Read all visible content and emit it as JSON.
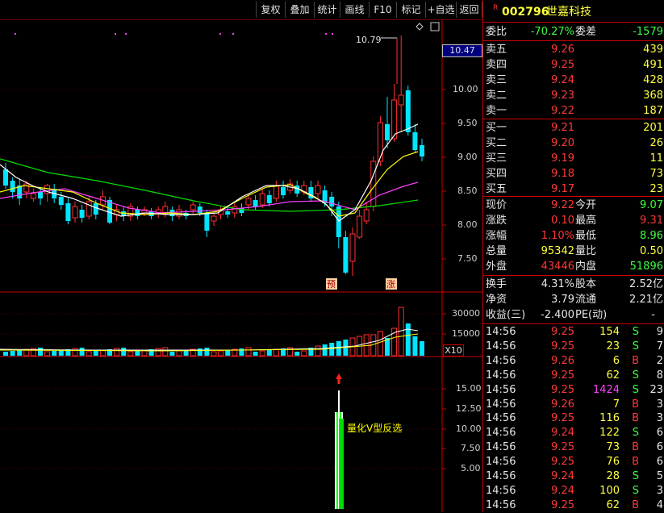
{
  "toolbar": {
    "buttons": [
      "复权",
      "叠加",
      "统计",
      "画线",
      "F10",
      "标记",
      "+自选",
      "返回"
    ]
  },
  "stock": {
    "marker": "R",
    "code": "002796",
    "name": "世嘉科技"
  },
  "price_axis": {
    "current_box": "10.47",
    "ticks": [
      "10.00",
      "9.50",
      "9.00",
      "8.50",
      "8.00",
      "7.50"
    ]
  },
  "high_annotation": "10.79",
  "signal_marks": {
    "yu": "预",
    "zhang": "涨"
  },
  "volume_axis": {
    "ticks": [
      "30000",
      "15000"
    ],
    "multiplier": "X10"
  },
  "indicator_axis": {
    "ticks": [
      "15.00",
      "12.50",
      "10.00",
      "7.50",
      "5.00"
    ],
    "label": "量化V型反选"
  },
  "colors": {
    "up": "#ff3030",
    "down": "#00e5ff",
    "ma5": "#ffffff",
    "ma10": "#ffff00",
    "ma20": "#ff40ff",
    "ma60": "#00ff00"
  },
  "order_book": {
    "wei_bi_label": "委比",
    "wei_bi": "-70.27%",
    "wei_cha_label": "委差",
    "wei_cha": "-1579",
    "asks": [
      {
        "label": "卖五",
        "price": "9.26",
        "vol": "439"
      },
      {
        "label": "卖四",
        "price": "9.25",
        "vol": "491"
      },
      {
        "label": "卖三",
        "price": "9.24",
        "vol": "428"
      },
      {
        "label": "卖二",
        "price": "9.23",
        "vol": "368"
      },
      {
        "label": "卖一",
        "price": "9.22",
        "vol": "187"
      }
    ],
    "bids": [
      {
        "label": "买一",
        "price": "9.21",
        "vol": "201"
      },
      {
        "label": "买二",
        "price": "9.20",
        "vol": "26"
      },
      {
        "label": "买三",
        "price": "9.19",
        "vol": "11"
      },
      {
        "label": "买四",
        "price": "9.18",
        "vol": "73"
      },
      {
        "label": "买五",
        "price": "9.17",
        "vol": "23"
      }
    ]
  },
  "quote": {
    "xianjia_label": "现价",
    "xianjia": "9.22",
    "jinkai_label": "今开",
    "jinkai": "9.07",
    "zhangdie_label": "涨跌",
    "zhangdie": "0.10",
    "zuigao_label": "最高",
    "zuigao": "9.31",
    "zhangfu_label": "涨幅",
    "zhangfu": "1.10%",
    "zuidi_label": "最低",
    "zuidi": "8.96",
    "zongliang_label": "总量",
    "zongliang": "95342",
    "liangbi_label": "量比",
    "liangbi": "0.50",
    "waipan_label": "外盘",
    "waipan": "43446",
    "neipan_label": "内盘",
    "neipan": "51896"
  },
  "finance": {
    "huanshou_label": "换手",
    "huanshou": "4.31%",
    "guben_label": "股本",
    "guben": "2.52亿",
    "jingzi_label": "净资",
    "jingzi": "3.79",
    "liutong_label": "流通",
    "liutong": "2.21亿",
    "shouyi_label": "收益(三)",
    "shouyi": "-2.400",
    "pe_label": "PE(动)",
    "pe": "-"
  },
  "ticks": [
    {
      "time": "14:56",
      "price": "9.25",
      "vol": "154",
      "side": "S",
      "n": "9"
    },
    {
      "time": "14:56",
      "price": "9.25",
      "vol": "23",
      "side": "S",
      "n": "7"
    },
    {
      "time": "14:56",
      "price": "9.26",
      "vol": "6",
      "side": "B",
      "n": "2"
    },
    {
      "time": "14:56",
      "price": "9.25",
      "vol": "62",
      "side": "S",
      "n": "8"
    },
    {
      "time": "14:56",
      "price": "9.25",
      "vol": "1424",
      "side": "S",
      "n": "23"
    },
    {
      "time": "14:56",
      "price": "9.26",
      "vol": "7",
      "side": "B",
      "n": "3"
    },
    {
      "time": "14:56",
      "price": "9.25",
      "vol": "116",
      "side": "B",
      "n": "3"
    },
    {
      "time": "14:56",
      "price": "9.24",
      "vol": "122",
      "side": "S",
      "n": "6"
    },
    {
      "time": "14:56",
      "price": "9.25",
      "vol": "73",
      "side": "B",
      "n": "6"
    },
    {
      "time": "14:56",
      "price": "9.25",
      "vol": "76",
      "side": "B",
      "n": "6"
    },
    {
      "time": "14:56",
      "price": "9.24",
      "vol": "28",
      "side": "S",
      "n": "5"
    },
    {
      "time": "14:56",
      "price": "9.24",
      "vol": "100",
      "side": "S",
      "n": "3"
    },
    {
      "time": "14:56",
      "price": "9.25",
      "vol": "62",
      "side": "B",
      "n": "4"
    }
  ]
}
